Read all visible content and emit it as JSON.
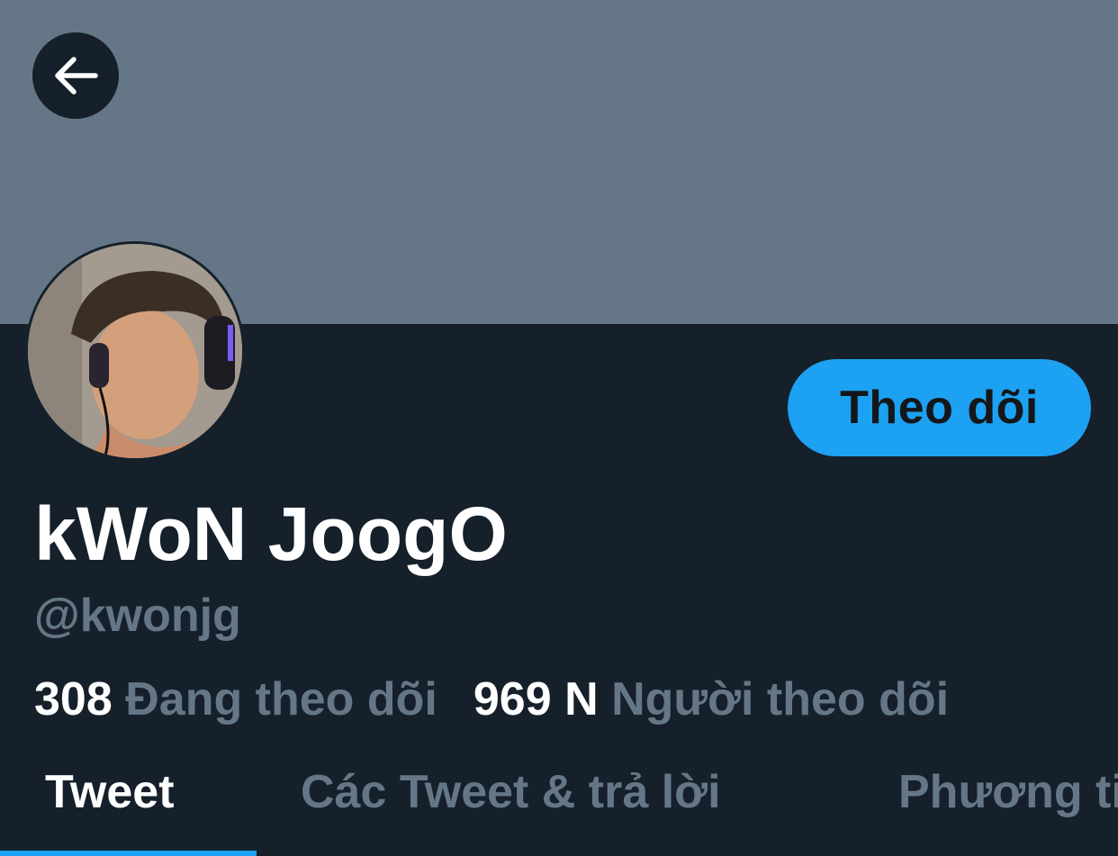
{
  "header": {
    "back_icon": "arrow-left-icon"
  },
  "profile": {
    "display_name": "kWoN JoogO",
    "handle": "@kwonjg",
    "follow_button": "Theo dõi",
    "following_count": "308",
    "following_label": "Đang theo dõi",
    "followers_count": "969 N",
    "followers_label": "Người theo dõi"
  },
  "tabs": [
    {
      "label": "Tweet",
      "active": true
    },
    {
      "label": "Các Tweet & trả lời",
      "active": false
    },
    {
      "label": "Phương tiện",
      "active": false
    }
  ],
  "colors": {
    "background": "#15202b",
    "banner": "#657786",
    "accent": "#1da1f2",
    "muted": "#657786",
    "text": "#ffffff"
  }
}
